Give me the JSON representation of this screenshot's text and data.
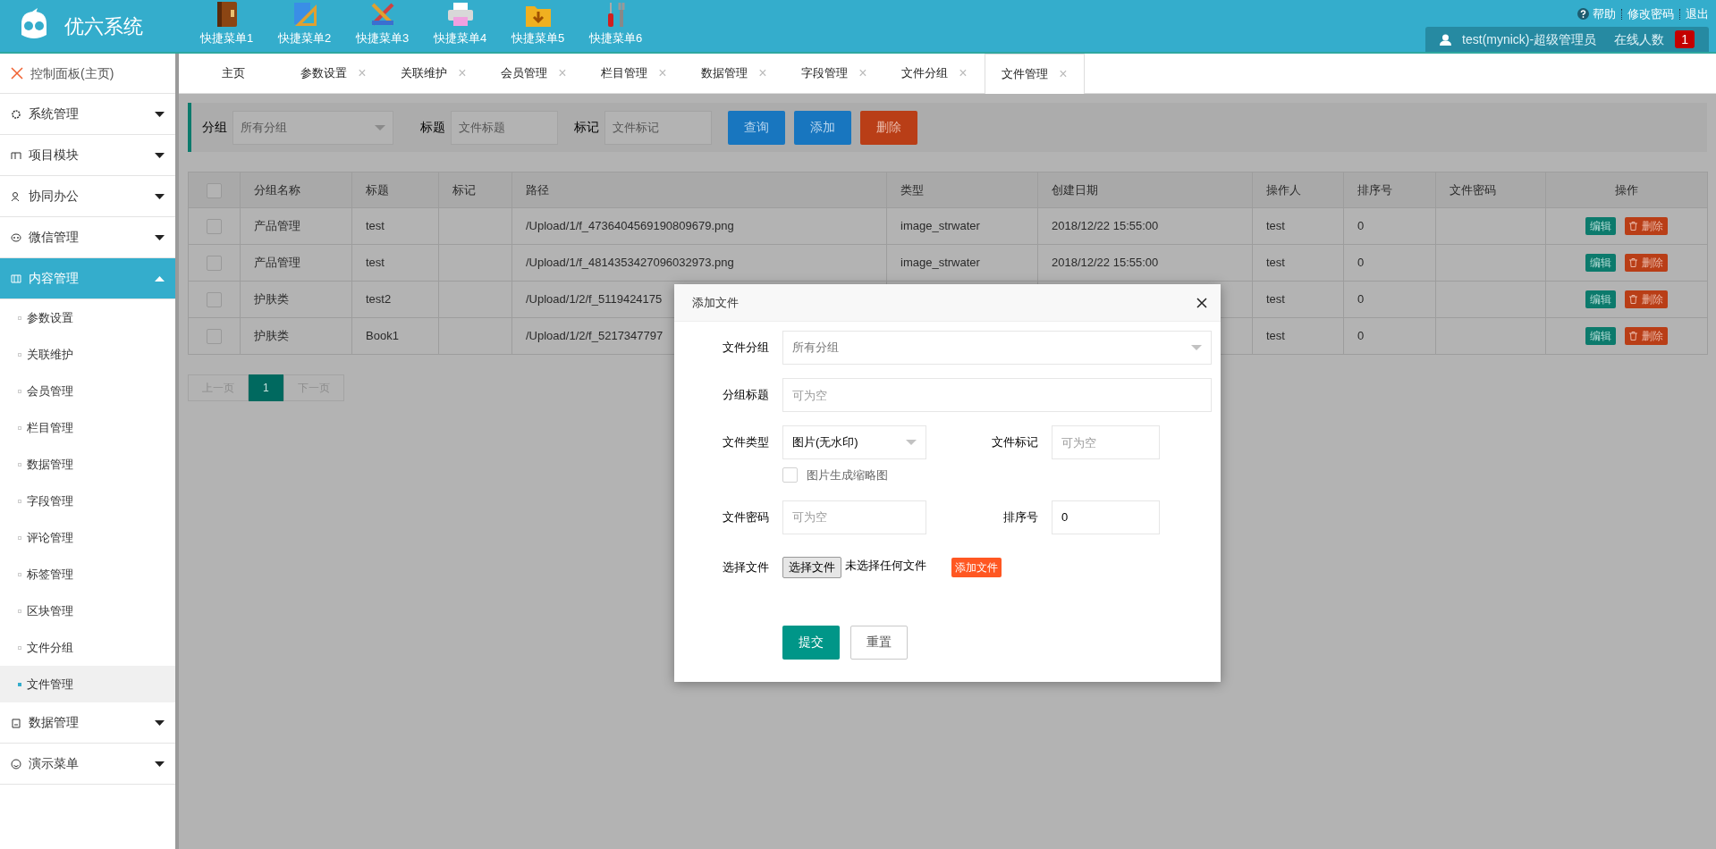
{
  "header": {
    "logo_text": "优六系统",
    "quick_menus": [
      "快捷菜单1",
      "快捷菜单2",
      "快捷菜单3",
      "快捷菜单4",
      "快捷菜单5",
      "快捷菜单6"
    ],
    "links": [
      "帮助",
      "修改密码",
      "退出"
    ],
    "user": "test(mynick)-超级管理员",
    "online_label": "在线人数",
    "online_count": "1"
  },
  "sidebar": {
    "home": "控制面板(主页)",
    "items": [
      {
        "label": "系统管理",
        "expanded": false
      },
      {
        "label": "项目模块",
        "expanded": false
      },
      {
        "label": "协同办公",
        "expanded": false
      },
      {
        "label": "微信管理",
        "expanded": false
      },
      {
        "label": "内容管理",
        "expanded": true,
        "children": [
          {
            "label": "参数设置",
            "selected": false
          },
          {
            "label": "关联维护",
            "selected": false
          },
          {
            "label": "会员管理",
            "selected": false
          },
          {
            "label": "栏目管理",
            "selected": false
          },
          {
            "label": "数据管理",
            "selected": false
          },
          {
            "label": "字段管理",
            "selected": false
          },
          {
            "label": "评论管理",
            "selected": false
          },
          {
            "label": "标签管理",
            "selected": false
          },
          {
            "label": "区块管理",
            "selected": false
          },
          {
            "label": "文件分组",
            "selected": false
          },
          {
            "label": "文件管理",
            "selected": true
          }
        ]
      },
      {
        "label": "数据管理",
        "expanded": false
      },
      {
        "label": "演示菜单",
        "expanded": false
      }
    ]
  },
  "tabs": [
    {
      "label": "主页",
      "closable": false,
      "selected": false
    },
    {
      "label": "参数设置",
      "closable": true,
      "selected": false
    },
    {
      "label": "关联维护",
      "closable": true,
      "selected": false
    },
    {
      "label": "会员管理",
      "closable": true,
      "selected": false
    },
    {
      "label": "栏目管理",
      "closable": true,
      "selected": false
    },
    {
      "label": "数据管理",
      "closable": true,
      "selected": false
    },
    {
      "label": "字段管理",
      "closable": true,
      "selected": false
    },
    {
      "label": "文件分组",
      "closable": true,
      "selected": false
    },
    {
      "label": "文件管理",
      "closable": true,
      "selected": true
    }
  ],
  "close_glyph": "×",
  "filter": {
    "group_label": "分组",
    "group_value": "所有分组",
    "title_label": "标题",
    "title_placeholder": "文件标题",
    "mark_label": "标记",
    "mark_placeholder": "文件标记",
    "buttons": [
      {
        "label": "查询",
        "kind": "primary"
      },
      {
        "label": "添加",
        "kind": "primary"
      },
      {
        "label": "删除",
        "kind": "danger"
      }
    ]
  },
  "table": {
    "select_all_checked": false,
    "columns": [
      "分组名称",
      "标题",
      "标记",
      "路径",
      "类型",
      "创建日期",
      "操作人",
      "排序号",
      "文件密码",
      "操作"
    ],
    "rows": [
      {
        "checked": false,
        "cells": [
          "产品管理",
          "test",
          null,
          "/Upload/1/f_4736404569190809679.png",
          "image_strwater",
          "2018/12/22 15:55:00",
          "test",
          "0",
          null
        ],
        "actions": [
          "编辑",
          "删除"
        ]
      },
      {
        "checked": false,
        "cells": [
          "产品管理",
          "test",
          null,
          "/Upload/1/f_4814353427096032973.png",
          "image_strwater",
          "2018/12/22 15:55:00",
          "test",
          "0",
          null
        ],
        "actions": [
          "编辑",
          "删除"
        ]
      },
      {
        "checked": false,
        "cells": [
          "护肤类",
          "test2",
          null,
          "/Upload/1/2/f_5119424175",
          null,
          null,
          "test",
          "0",
          null
        ],
        "actions": [
          "编辑",
          "删除"
        ]
      },
      {
        "checked": false,
        "cells": [
          "护肤类",
          "Book1",
          null,
          "/Upload/1/2/f_5217347797",
          null,
          null,
          "test",
          "0",
          null
        ],
        "actions": [
          "编辑",
          "删除"
        ]
      }
    ]
  },
  "pagination": [
    {
      "label": "上一页",
      "disabled": true,
      "selected": false
    },
    {
      "label": "1",
      "disabled": false,
      "selected": true
    },
    {
      "label": "下一页",
      "disabled": true,
      "selected": false
    }
  ],
  "modal": {
    "title": "添加文件",
    "group": {
      "label": "文件分组",
      "placeholder": "所有分组"
    },
    "group_title": {
      "label": "分组标题",
      "placeholder": "可为空"
    },
    "type": {
      "label": "文件类型",
      "value": "图片(无水印)"
    },
    "mark": {
      "label": "文件标记",
      "placeholder": "可为空"
    },
    "thumbnail": {
      "label": "图片生成缩略图",
      "checked": false
    },
    "password": {
      "label": "文件密码",
      "placeholder": "可为空"
    },
    "sort": {
      "label": "排序号",
      "value": "0"
    },
    "file": {
      "label": "选择文件",
      "button": "选择文件",
      "status": "未选择任何文件",
      "add_button": "添加文件"
    },
    "buttons": [
      {
        "label": "提交",
        "kind": "primary"
      },
      {
        "label": "重置",
        "kind": "default"
      }
    ]
  }
}
